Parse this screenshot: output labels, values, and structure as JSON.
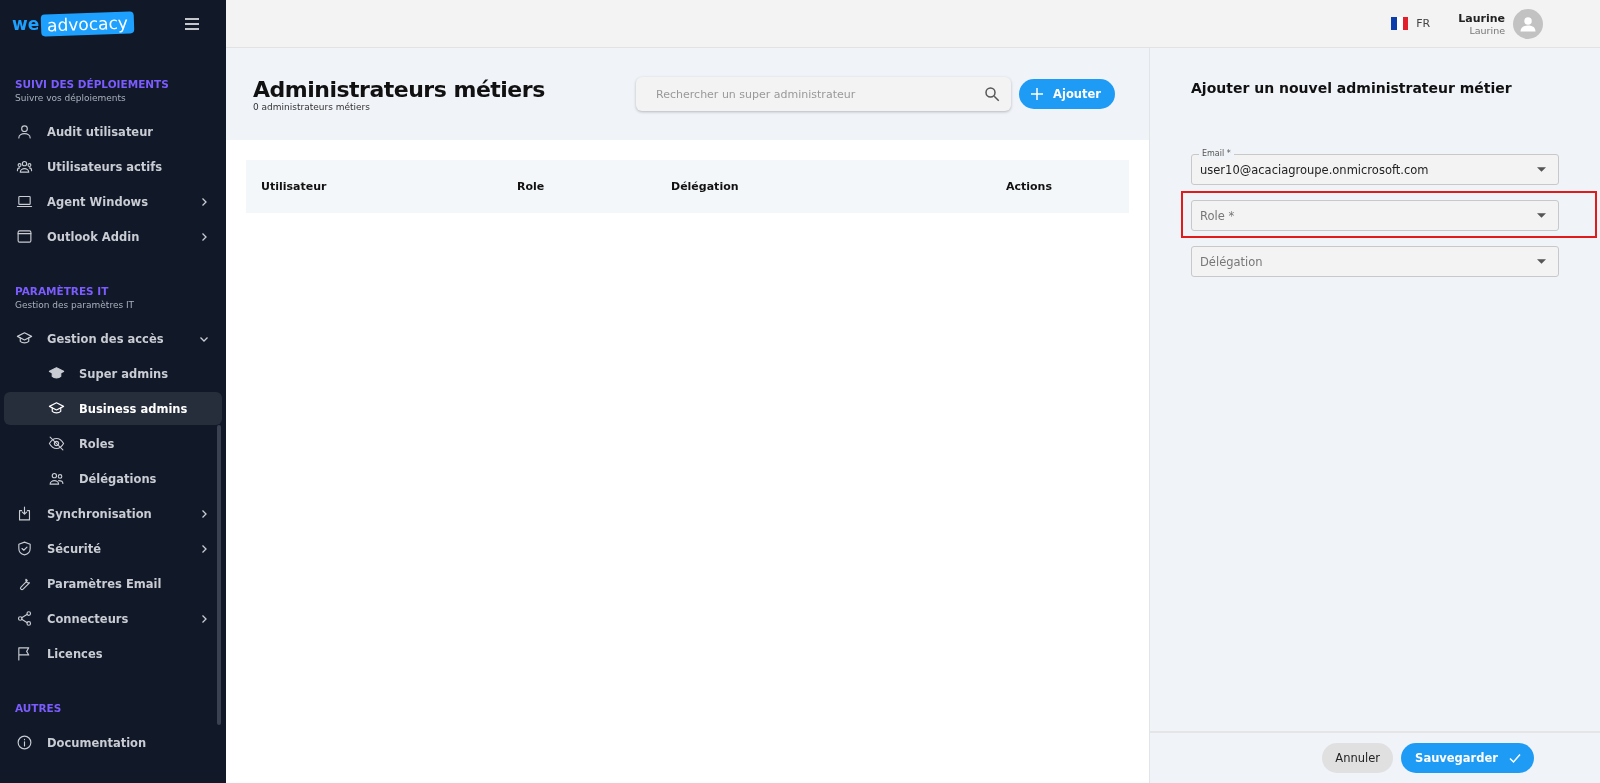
{
  "logo": {
    "prefix": "we",
    "badge": "advocacy"
  },
  "sidebar": {
    "sections": [
      {
        "title": "SUIVI DES DÉPLOIEMENTS",
        "subtitle": "Suivre vos déploiements",
        "items": [
          {
            "label": "Audit utilisateur",
            "kind": "link",
            "selected": false
          },
          {
            "label": "Utilisateurs actifs",
            "kind": "link",
            "selected": false
          },
          {
            "label": "Agent Windows",
            "kind": "group",
            "expanded": false,
            "selected": false
          },
          {
            "label": "Outlook Addin",
            "kind": "group",
            "expanded": false,
            "selected": false
          }
        ]
      },
      {
        "title": "PARAMÈTRES IT",
        "subtitle": "Gestion des paramètres IT",
        "items": [
          {
            "label": "Gestion des accès",
            "kind": "group",
            "expanded": true,
            "selected": false,
            "children": [
              {
                "label": "Super admins",
                "selected": false
              },
              {
                "label": "Business admins",
                "selected": true
              },
              {
                "label": "Roles",
                "selected": false
              },
              {
                "label": "Délégations",
                "selected": false
              }
            ]
          },
          {
            "label": "Synchronisation",
            "kind": "group",
            "expanded": false,
            "selected": false
          },
          {
            "label": "Sécurité",
            "kind": "group",
            "expanded": false,
            "selected": false
          },
          {
            "label": "Paramètres Email",
            "kind": "link",
            "selected": false
          },
          {
            "label": "Connecteurs",
            "kind": "group",
            "expanded": false,
            "selected": false
          },
          {
            "label": "Licences",
            "kind": "link",
            "selected": false
          }
        ]
      },
      {
        "title": "AUTRES",
        "items": [
          {
            "label": "Documentation",
            "kind": "link",
            "selected": false
          }
        ]
      }
    ]
  },
  "topbar": {
    "language": "FR",
    "user_name": "Laurine",
    "user_subtitle": "Laurine"
  },
  "page": {
    "title": "Administrateurs métiers",
    "subtitle": "0 administrateurs métiers",
    "search": {
      "placeholder": "Rechercher un super administrateur"
    },
    "add_button": "Ajouter"
  },
  "table": {
    "columns": [
      "Utilisateur",
      "Role",
      "Délégation",
      "Actions"
    ]
  },
  "panel": {
    "title": "Ajouter un nouvel administrateur métier",
    "fields": [
      {
        "label": "Email *",
        "value": "user10@acaciagroupe.onmicrosoft.com",
        "highlighted": false
      },
      {
        "label": "Role *",
        "highlighted": true
      },
      {
        "label": "Délégation",
        "highlighted": false
      }
    ],
    "cancel_button": "Annuler",
    "save_button": "Sauvegarder"
  }
}
